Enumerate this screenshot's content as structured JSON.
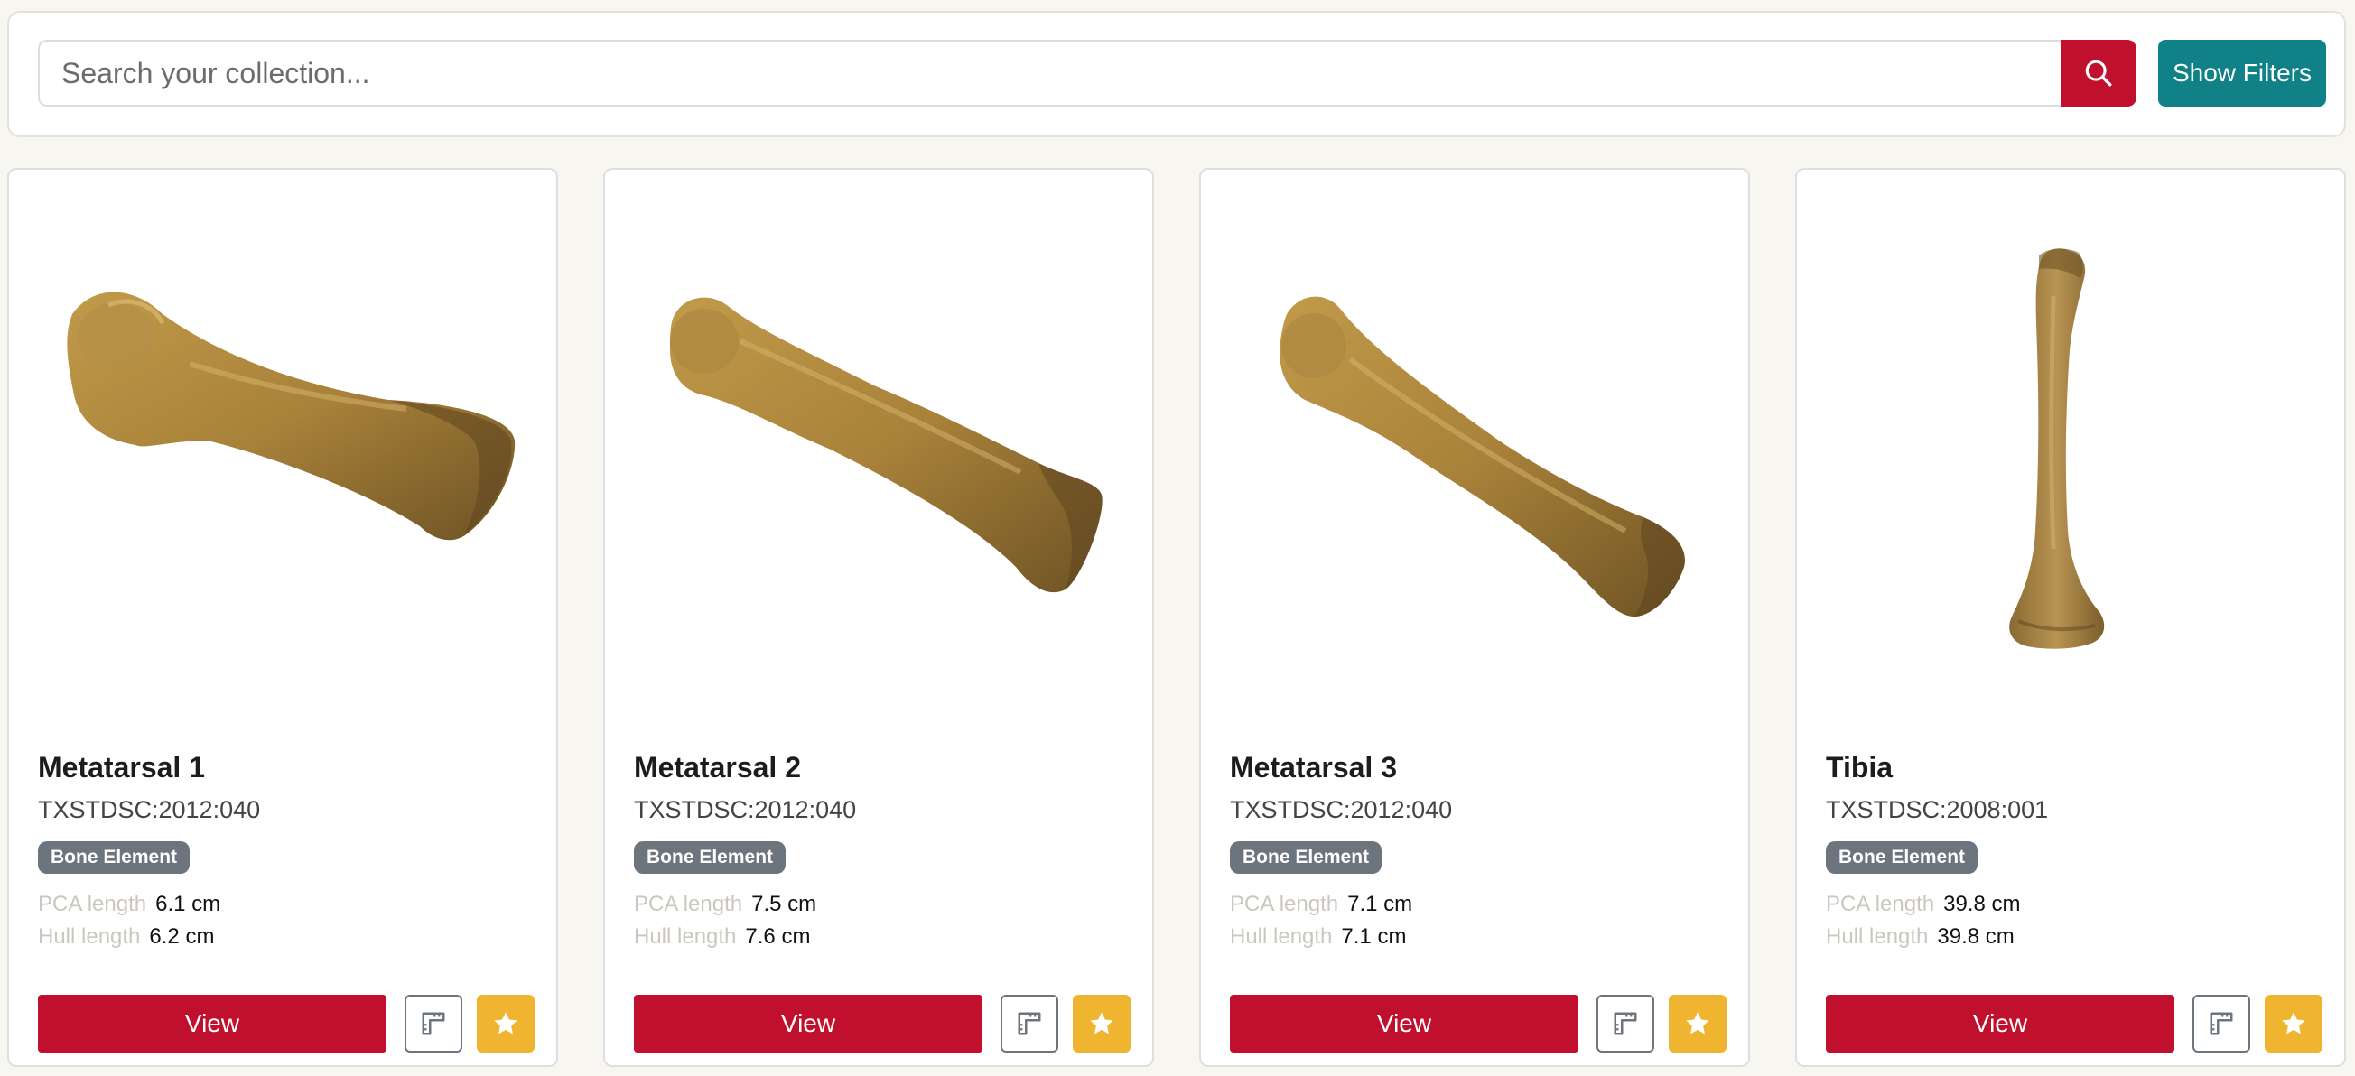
{
  "search": {
    "placeholder": "Search your collection...",
    "search_icon": "search-icon",
    "filters_label": "Show Filters"
  },
  "colors": {
    "primary": "#c0102e",
    "teal": "#0f8187",
    "badge": "#6c757d",
    "favorite": "#f0b530",
    "background": "#f8f6f0"
  },
  "labels": {
    "pca": "PCA length",
    "hull": "Hull length",
    "view": "View"
  },
  "cards": [
    {
      "title": "Metatarsal 1",
      "id": "TXSTDSC:2012:040",
      "badge": "Bone Element",
      "pca": "6.1 cm",
      "hull": "6.2 cm",
      "image": "metatarsal-bone-image"
    },
    {
      "title": "Metatarsal 2",
      "id": "TXSTDSC:2012:040",
      "badge": "Bone Element",
      "pca": "7.5 cm",
      "hull": "7.6 cm",
      "image": "metatarsal-bone-image"
    },
    {
      "title": "Metatarsal 3",
      "id": "TXSTDSC:2012:040",
      "badge": "Bone Element",
      "pca": "7.1 cm",
      "hull": "7.1 cm",
      "image": "metatarsal-bone-image"
    },
    {
      "title": "Tibia",
      "id": "TXSTDSC:2008:001",
      "badge": "Bone Element",
      "pca": "39.8 cm",
      "hull": "39.8 cm",
      "image": "tibia-bone-image"
    }
  ]
}
